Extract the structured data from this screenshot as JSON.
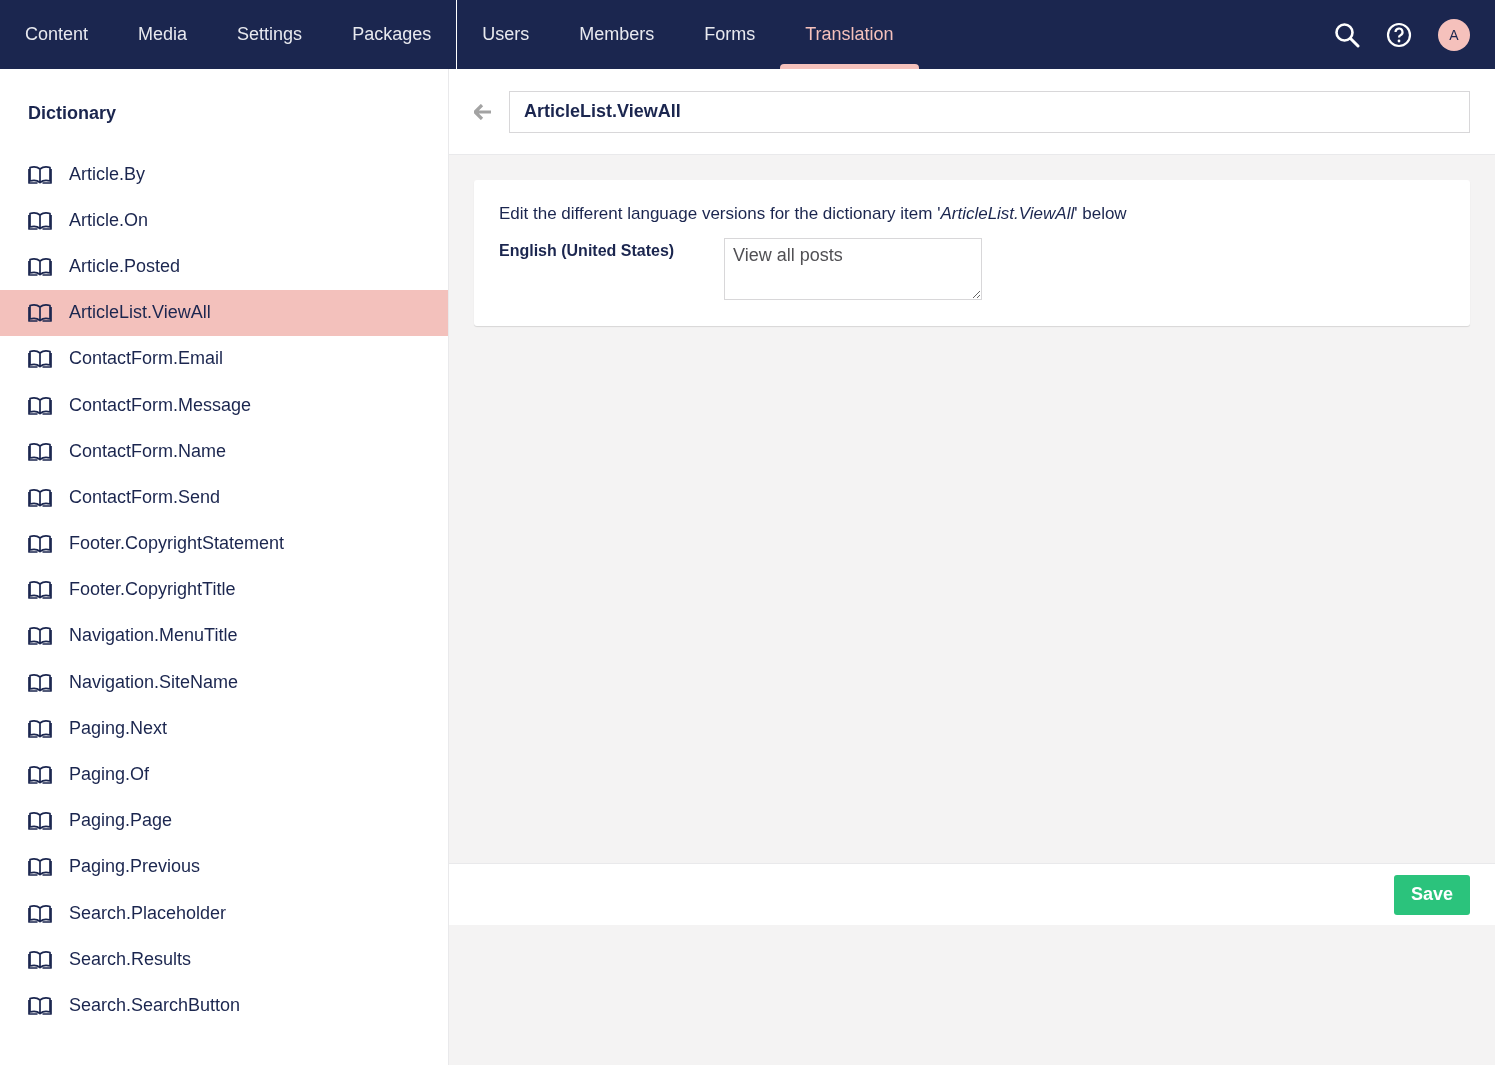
{
  "top_nav": {
    "sections": [
      {
        "label": "Content",
        "selected": false
      },
      {
        "label": "Media",
        "selected": false
      },
      {
        "label": "Settings",
        "selected": false
      },
      {
        "label": "Packages",
        "selected": false
      },
      {
        "label": "Users",
        "selected": false
      },
      {
        "label": "Members",
        "selected": false
      },
      {
        "label": "Forms",
        "selected": false
      },
      {
        "label": "Translation",
        "selected": true
      }
    ],
    "avatar": "A"
  },
  "sidebar": {
    "title": "Dictionary",
    "items": [
      {
        "label": "Article.By",
        "selected": false
      },
      {
        "label": "Article.On",
        "selected": false
      },
      {
        "label": "Article.Posted",
        "selected": false
      },
      {
        "label": "ArticleList.ViewAll",
        "selected": true
      },
      {
        "label": "ContactForm.Email",
        "selected": false
      },
      {
        "label": "ContactForm.Message",
        "selected": false
      },
      {
        "label": "ContactForm.Name",
        "selected": false
      },
      {
        "label": "ContactForm.Send",
        "selected": false
      },
      {
        "label": "Footer.CopyrightStatement",
        "selected": false
      },
      {
        "label": "Footer.CopyrightTitle",
        "selected": false
      },
      {
        "label": "Navigation.MenuTitle",
        "selected": false
      },
      {
        "label": "Navigation.SiteName",
        "selected": false
      },
      {
        "label": "Paging.Next",
        "selected": false
      },
      {
        "label": "Paging.Of",
        "selected": false
      },
      {
        "label": "Paging.Page",
        "selected": false
      },
      {
        "label": "Paging.Previous",
        "selected": false
      },
      {
        "label": "Search.Placeholder",
        "selected": false
      },
      {
        "label": "Search.Results",
        "selected": false
      },
      {
        "label": "Search.SearchButton",
        "selected": false
      }
    ]
  },
  "editor": {
    "name": "ArticleList.ViewAll",
    "description": "Edit the different language versions for the dictionary item '*ArticleList.ViewAll*' below",
    "translations": [
      {
        "language": "English (United States)",
        "value": "View all posts"
      }
    ],
    "save_button": "Save"
  }
}
